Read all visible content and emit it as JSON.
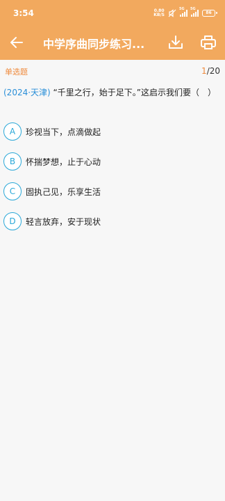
{
  "status": {
    "time": "3:54",
    "net_speed_value": "0.80",
    "net_speed_unit": "KB/S",
    "sim1_tag": "5G",
    "sim2_tag": "5G",
    "battery": "86"
  },
  "header": {
    "title": "中学序曲同步练习..."
  },
  "question_meta": {
    "type": "单选题",
    "current": "1",
    "total": "/20"
  },
  "question": {
    "source": "(2024·天津)",
    "text": " “千里之行，始于足下。”这启示我们要（　）"
  },
  "options": [
    {
      "letter": "A",
      "text": "珍视当下，点滴做起"
    },
    {
      "letter": "B",
      "text": "怀揣梦想，止于心动"
    },
    {
      "letter": "C",
      "text": "固执己见，乐享生活"
    },
    {
      "letter": "D",
      "text": "轻言放弃，安于现状"
    }
  ]
}
